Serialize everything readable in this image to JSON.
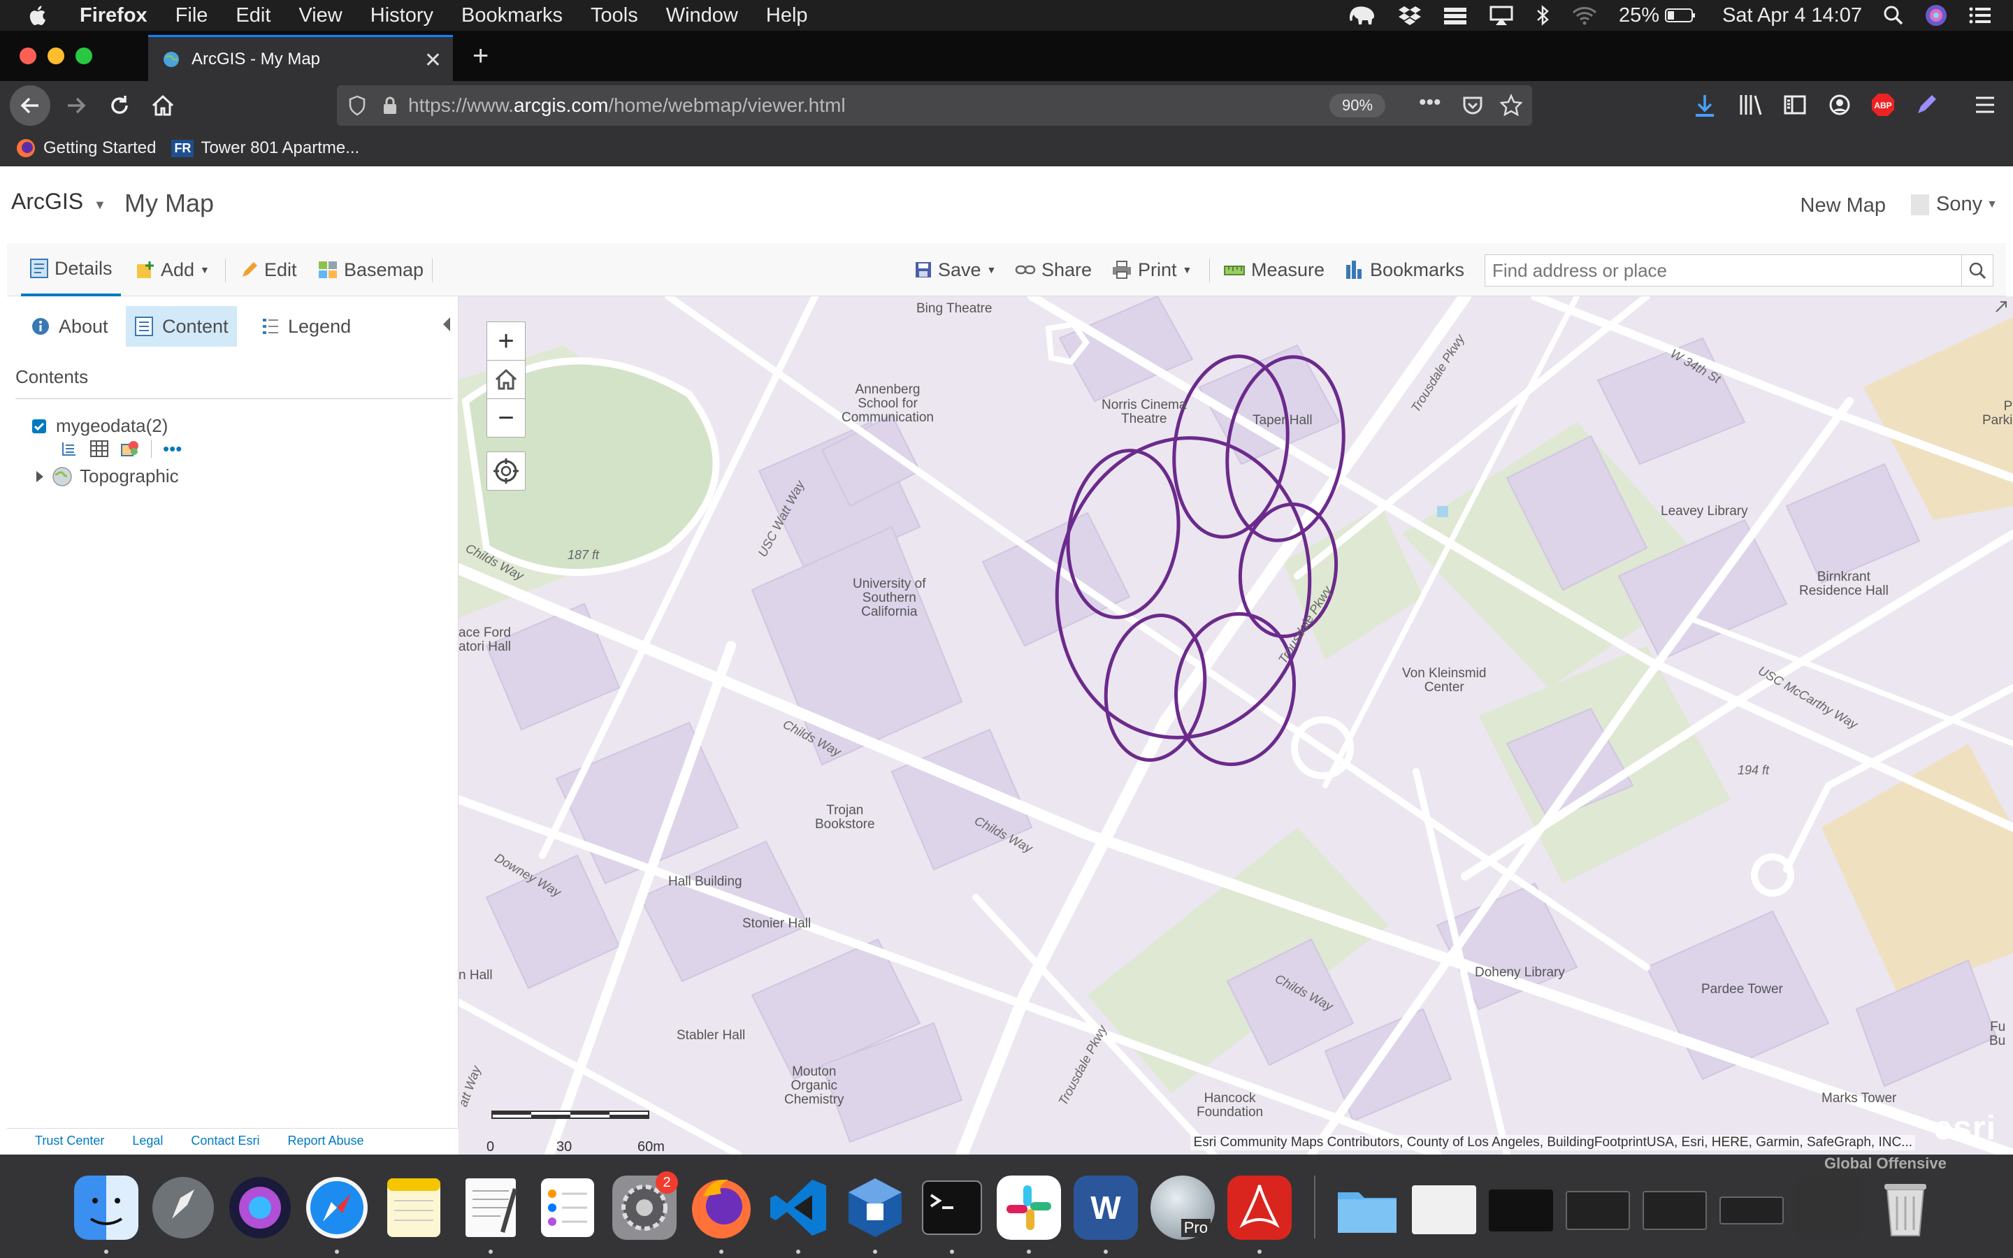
{
  "menubar": {
    "app_name": "Firefox",
    "items": [
      "File",
      "Edit",
      "View",
      "History",
      "Bookmarks",
      "Tools",
      "Window",
      "Help"
    ],
    "battery": "25%",
    "clock": "Sat Apr 4  14:07"
  },
  "browser": {
    "tab_title": "ArcGIS - My Map",
    "url_prefix": "https://www.",
    "url_host": "arcgis.com",
    "url_path": "/home/webmap/viewer.html",
    "zoom": "90%",
    "bookmarks": [
      {
        "label": "Getting Started"
      },
      {
        "label": "Tower 801 Apartme...",
        "badge": "FR"
      }
    ]
  },
  "arcgis": {
    "logo": "ArcGIS",
    "map_title": "My Map",
    "new_map": "New Map",
    "user": "Sony",
    "toolbar": {
      "details": "Details",
      "add": "Add",
      "edit": "Edit",
      "basemap": "Basemap",
      "save": "Save",
      "share": "Share",
      "print": "Print",
      "measure": "Measure",
      "bookmarks": "Bookmarks",
      "search_placeholder": "Find address or place"
    },
    "panel": {
      "tabs": {
        "about": "About",
        "content": "Content",
        "legend": "Legend"
      },
      "contents_heading": "Contents",
      "layers": [
        {
          "name": "mygeodata(2)",
          "checked": true
        },
        {
          "name": "Topographic"
        }
      ],
      "footer_links": [
        "Trust Center",
        "Legal",
        "Contact Esri",
        "Report Abuse"
      ]
    },
    "map": {
      "labels": {
        "bing_theatre": "Bing Theatre",
        "annenberg": "Annenberg\nSchool for\nCommunication",
        "norris": "Norris Cinema\nTheatre",
        "taper": "Taper Hall",
        "leavey": "Leavey Library",
        "birnkrant": "Birnkrant\nResidence Hall",
        "usc": "University of\nSouthern\nCalifornia",
        "ace_ford": "ace Ford\natori Hall",
        "kleinsmid": "Von Kleinsmid\nCenter",
        "trojan": "Trojan\nBookstore",
        "hall_building": "Hall Building",
        "stonier": "Stonier Hall",
        "hall": "n Hall",
        "stabler": "Stabler Hall",
        "mouton": "Mouton\nOrganic\nChemistry",
        "hancock": "Hancock\nFoundation",
        "doheny": "Doheny Library",
        "pardee": "Pardee Tower",
        "marks": "Marks Tower",
        "puparking": "Pu\nParkin",
        "fu": "Fu\nBu",
        "elev1": "187 ft",
        "elev2": "194 ft"
      },
      "streets": {
        "childs_way": "Childs Way",
        "usc_watt": "USC Watt Way",
        "trousdale": "Trousdale Pkwy",
        "w34th": "W 34th St",
        "usc_mccarthy": "USC McCarthy Way",
        "downey": "Downey Way",
        "att_way": "att Way"
      },
      "scale": {
        "s0": "0",
        "s1": "30",
        "s2": "60m"
      },
      "attribution": "Esri Community Maps Contributors, County of Los Angeles, BuildingFootprintUSA, Esri, HERE, Garmin, SafeGraph, INC...",
      "esri": "esri",
      "polygon_color": "#6b2a8c"
    }
  },
  "dock": {
    "settings_badge": "2",
    "pro_label": "Pro",
    "word_label": "W",
    "global_offensive": "Global Offensive"
  }
}
